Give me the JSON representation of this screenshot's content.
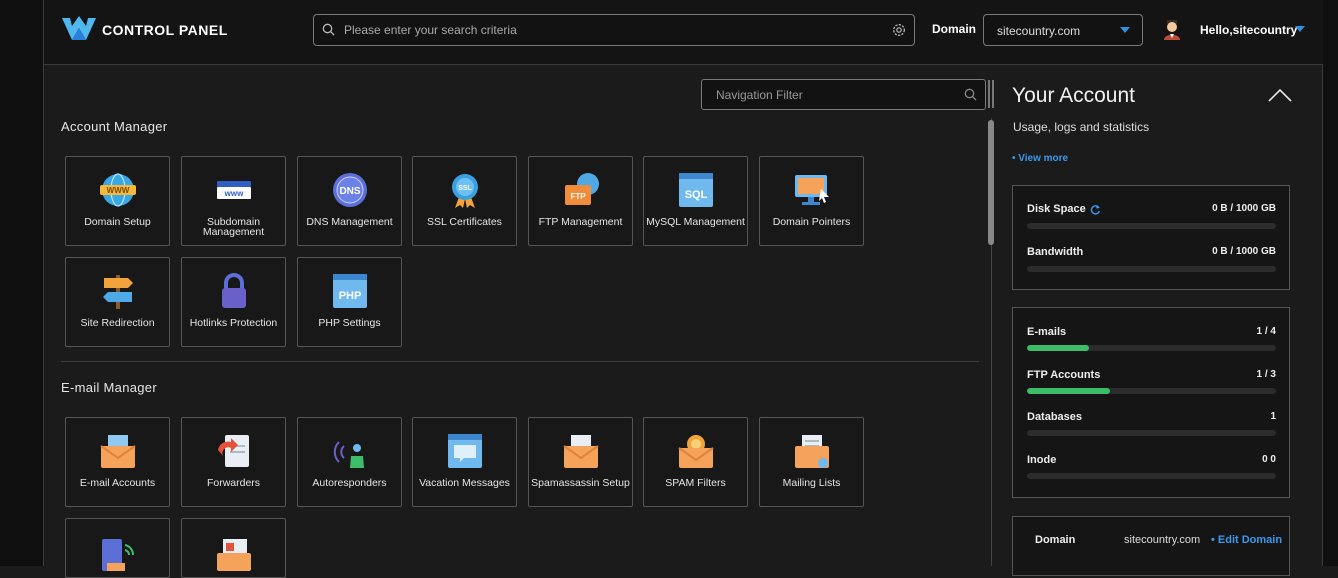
{
  "header": {
    "brand": "CONTROL PANEL",
    "search_placeholder": "Please enter your search criteria",
    "domain_label": "Domain",
    "domain_value": "sitecountry.com",
    "greeting": "Hello,sitecountry"
  },
  "nav_filter": {
    "placeholder": "Navigation Filter"
  },
  "account_manager": {
    "title": "Account Manager",
    "items": [
      {
        "label": "Domain Setup",
        "icon": "globe-www-icon"
      },
      {
        "label": "Subdomain Management",
        "icon": "subdomain-icon"
      },
      {
        "label": "DNS Management",
        "icon": "dns-globe-icon"
      },
      {
        "label": "SSL Certificates",
        "icon": "ssl-badge-icon"
      },
      {
        "label": "FTP Management",
        "icon": "ftp-folder-icon"
      },
      {
        "label": "MySQL Management",
        "icon": "sql-window-icon"
      },
      {
        "label": "Domain Pointers",
        "icon": "monitor-pointer-icon"
      },
      {
        "label": "Site Redirection",
        "icon": "signpost-icon"
      },
      {
        "label": "Hotlinks Protection",
        "icon": "padlock-icon"
      },
      {
        "label": "PHP Settings",
        "icon": "php-window-icon"
      }
    ]
  },
  "email_manager": {
    "title": "E-mail Manager",
    "items": [
      {
        "label": "E-mail Accounts",
        "icon": "envelope-icon"
      },
      {
        "label": "Forwarders",
        "icon": "forward-document-icon"
      },
      {
        "label": "Autoresponders",
        "icon": "broadcast-person-icon"
      },
      {
        "label": "Vacation Messages",
        "icon": "vacation-window-icon"
      },
      {
        "label": "Spamassassin Setup",
        "icon": "spam-envelope-icon"
      },
      {
        "label": "SPAM Filters",
        "icon": "filter-envelope-icon"
      },
      {
        "label": "Mailing Lists",
        "icon": "mailing-list-icon"
      },
      {
        "label": "",
        "icon": "wireless-device-icon"
      },
      {
        "label": "",
        "icon": "newsletter-icon"
      }
    ]
  },
  "account_panel": {
    "title": "Your Account",
    "subtitle": "Usage, logs and statistics",
    "view_more": "• View more",
    "resources": [
      {
        "name": "Disk Space",
        "value": "0 B / 1000 GB",
        "fill": 0
      },
      {
        "name": "Bandwidth",
        "value": "0 B / 1000 GB",
        "fill": 0
      }
    ],
    "limits": [
      {
        "name": "E-mails",
        "value": "1 / 4",
        "fill": 0.25
      },
      {
        "name": "FTP Accounts",
        "value": "1 / 3",
        "fill": 0.333
      },
      {
        "name": "Databases",
        "value": "1",
        "fill": 0
      },
      {
        "name": "Inode",
        "value": "0 0",
        "fill": 0
      }
    ],
    "domain_info": {
      "label": "Domain",
      "value": "sitecountry.com",
      "edit": "• Edit Domain"
    }
  },
  "colors": {
    "accent": "#3b98f0",
    "progress": "#3dbd6a",
    "background": "#1b1b1b"
  }
}
